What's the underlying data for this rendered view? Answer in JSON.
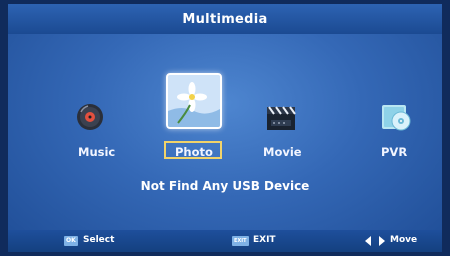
{
  "header": {
    "title": "Multimedia"
  },
  "menu": {
    "items": [
      {
        "label": "Music",
        "icon": "music-disc-icon"
      },
      {
        "label": "Photo",
        "icon": "photo-flower-icon",
        "selected": true
      },
      {
        "label": "Movie",
        "icon": "clapperboard-icon"
      },
      {
        "label": "PVR",
        "icon": "pvr-disc-icon"
      }
    ]
  },
  "status": {
    "message": "Not Find Any USB Device"
  },
  "footer": {
    "ok_key": "OK",
    "select_label": "Select",
    "exit_key": "EXIT",
    "exit_label": "EXIT",
    "move_label": "Move"
  },
  "colors": {
    "background": "#3468b6",
    "selection_border": "#f1d36a",
    "footer": "#14407f"
  }
}
